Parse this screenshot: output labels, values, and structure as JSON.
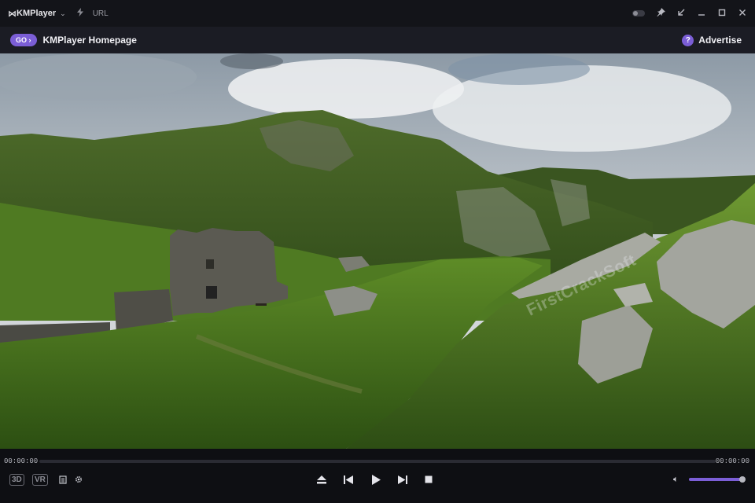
{
  "titlebar": {
    "app_name": "KMPlayer",
    "logo_mark": "⋈",
    "url_label": "URL",
    "icons": [
      "chevron-down-icon",
      "lightning-icon",
      "toggle-switch",
      "pin-icon",
      "shrink-icon",
      "minimize-icon",
      "maximize-icon",
      "close-icon"
    ]
  },
  "adbar": {
    "go_label": "GO ›",
    "title": "KMPlayer Homepage",
    "help_glyph": "?",
    "advertise_label": "Advertise"
  },
  "video": {
    "watermark": "FirstCrackSoft",
    "scene": "landscape-with-castle-ruins"
  },
  "controls": {
    "time_current": "00:00:00",
    "time_total": "00:00:00",
    "seek_progress": 0,
    "badge_3d": "3D",
    "badge_vr": "VR",
    "volume": 0.97,
    "accent": "#7b5ed6"
  }
}
